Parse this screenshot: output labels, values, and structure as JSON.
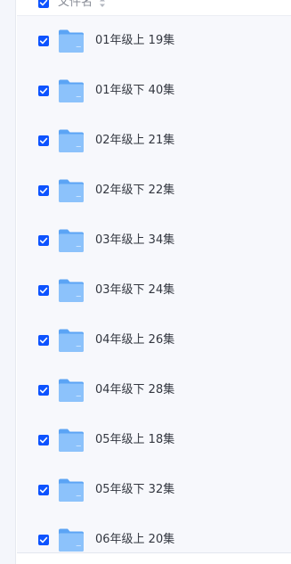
{
  "header": {
    "column_label": "文件名",
    "checked": true
  },
  "files": [
    {
      "name": "01年级上 19集",
      "checked": true,
      "icon": "folder-icon"
    },
    {
      "name": "01年级下 40集",
      "checked": true,
      "icon": "folder-icon"
    },
    {
      "name": "02年级上 21集",
      "checked": true,
      "icon": "folder-icon"
    },
    {
      "name": "02年级下 22集",
      "checked": true,
      "icon": "folder-icon"
    },
    {
      "name": "03年级上 34集",
      "checked": true,
      "icon": "folder-icon"
    },
    {
      "name": "03年级下 24集",
      "checked": true,
      "icon": "folder-icon"
    },
    {
      "name": "04年级上 26集",
      "checked": true,
      "icon": "folder-icon"
    },
    {
      "name": "04年级下 28集",
      "checked": true,
      "icon": "folder-icon"
    },
    {
      "name": "05年级上 18集",
      "checked": true,
      "icon": "folder-icon"
    },
    {
      "name": "05年级下 32集",
      "checked": true,
      "icon": "folder-icon"
    },
    {
      "name": "06年级上 20集",
      "checked": true,
      "icon": "folder-icon"
    }
  ],
  "colors": {
    "checkbox": "#0d53ff",
    "folder_back": "#5ba4f5",
    "folder_front": "#8cc2fb",
    "panel_bg": "#f7f8fc"
  }
}
